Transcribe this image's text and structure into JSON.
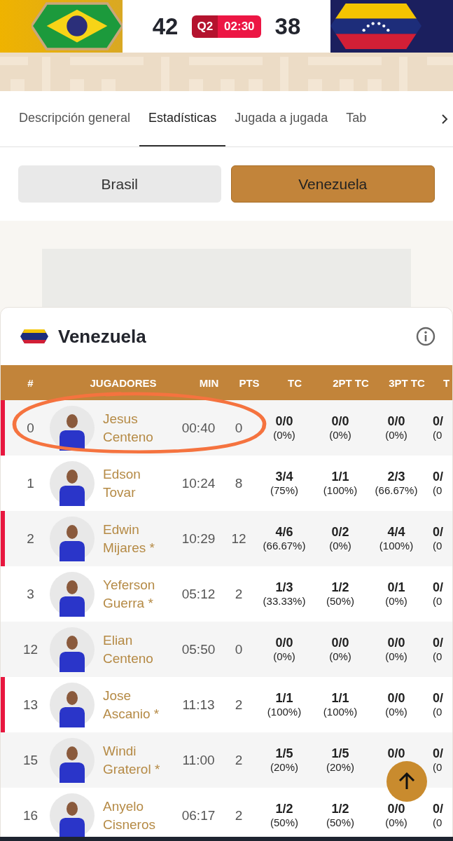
{
  "scoreboard": {
    "home_score": "42",
    "period": "Q2",
    "clock": "02:30",
    "away_score": "38"
  },
  "tabs": [
    {
      "label": "Descripción general",
      "selected": false
    },
    {
      "label": "Estadísticas",
      "selected": true
    },
    {
      "label": "Jugada a jugada",
      "selected": false
    },
    {
      "label": "Tab",
      "selected": false
    }
  ],
  "team_buttons": [
    {
      "label": "Brasil",
      "selected": false
    },
    {
      "label": "Venezuela",
      "selected": true
    }
  ],
  "card": {
    "title": "Venezuela"
  },
  "table": {
    "columns": [
      "#",
      "JUGADORES",
      "MIN",
      "PTS",
      "TC",
      "2PT TC",
      "3PT TC",
      "T"
    ],
    "rows": [
      {
        "number": "0",
        "name": "Jesus",
        "surname": "Centeno",
        "min": "00:40",
        "pts": "0",
        "stats": [
          [
            "0/0",
            "(0%)"
          ],
          [
            "0/0",
            "(0%)"
          ],
          [
            "0/0",
            "(0%)"
          ],
          [
            "0/",
            "(0"
          ]
        ],
        "highlighted": true
      },
      {
        "number": "1",
        "name": "Edson",
        "surname": "Tovar",
        "min": "10:24",
        "pts": "8",
        "stats": [
          [
            "3/4",
            "(75%)"
          ],
          [
            "1/1",
            "(100%)"
          ],
          [
            "2/3",
            "(66.67%)"
          ],
          [
            "0/",
            "(0"
          ]
        ],
        "highlighted": false
      },
      {
        "number": "2",
        "name": "Edwin",
        "surname": "Mijares *",
        "min": "10:29",
        "pts": "12",
        "stats": [
          [
            "4/6",
            "(66.67%)"
          ],
          [
            "0/2",
            "(0%)"
          ],
          [
            "4/4",
            "(100%)"
          ],
          [
            "0/",
            "(0"
          ]
        ],
        "highlighted": true
      },
      {
        "number": "3",
        "name": "Yeferson",
        "surname": "Guerra *",
        "min": "05:12",
        "pts": "2",
        "stats": [
          [
            "1/3",
            "(33.33%)"
          ],
          [
            "1/2",
            "(50%)"
          ],
          [
            "0/1",
            "(0%)"
          ],
          [
            "0/",
            "(0"
          ]
        ],
        "highlighted": false
      },
      {
        "number": "12",
        "name": "Elian",
        "surname": "Centeno",
        "min": "05:50",
        "pts": "0",
        "stats": [
          [
            "0/0",
            "(0%)"
          ],
          [
            "0/0",
            "(0%)"
          ],
          [
            "0/0",
            "(0%)"
          ],
          [
            "0/",
            "(0"
          ]
        ],
        "highlighted": false
      },
      {
        "number": "13",
        "name": "Jose",
        "surname": "Ascanio *",
        "min": "11:13",
        "pts": "2",
        "stats": [
          [
            "1/1",
            "(100%)"
          ],
          [
            "1/1",
            "(100%)"
          ],
          [
            "0/0",
            "(0%)"
          ],
          [
            "0/",
            "(0"
          ]
        ],
        "highlighted": true
      },
      {
        "number": "15",
        "name": "Windi",
        "surname": "Graterol *",
        "min": "11:00",
        "pts": "2",
        "stats": [
          [
            "1/5",
            "(20%)"
          ],
          [
            "1/5",
            "(20%)"
          ],
          [
            "0/0"
          ],
          [
            "0/",
            "(0"
          ]
        ],
        "highlighted": false
      },
      {
        "number": "16",
        "name": "Anyelo",
        "surname": "Cisneros",
        "min": "06:17",
        "pts": "2",
        "stats": [
          [
            "1/2",
            "(50%)"
          ],
          [
            "1/2",
            "(50%)"
          ],
          [
            "0/0",
            "(0%)"
          ],
          [
            "0/",
            "(0"
          ]
        ],
        "highlighted": false
      }
    ]
  }
}
